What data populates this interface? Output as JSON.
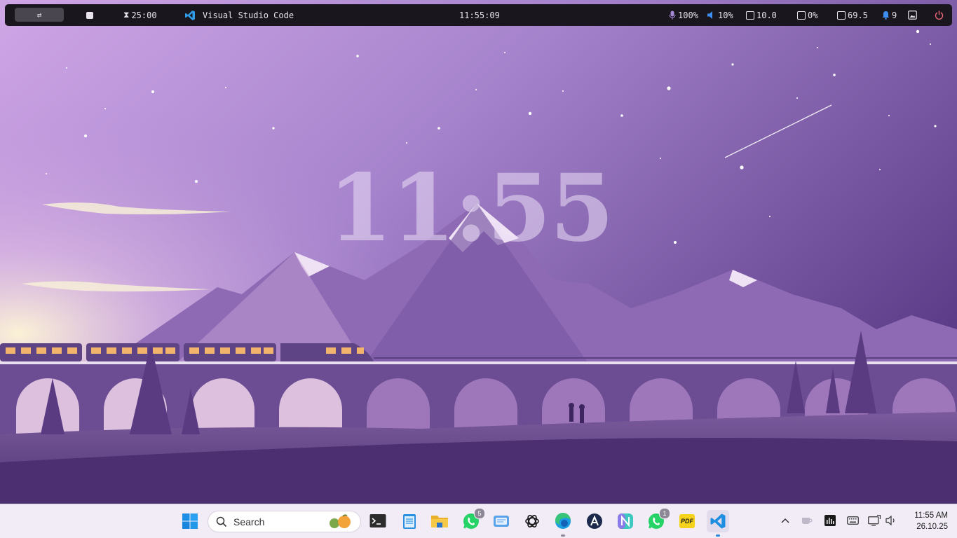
{
  "topbar": {
    "workspace_icon": "swap-arrows-icon",
    "timer": "25:00",
    "active_app": "Visual Studio Code",
    "clock": "11:55:09",
    "mic": "100%",
    "volume": "10%",
    "cpu": "10.0",
    "gpu": "0%",
    "memory": "69.5",
    "notifications": "9"
  },
  "wallpaper": {
    "clock_overlay": "11:55",
    "colors": {
      "sky_top": "#c59ee0",
      "sky_mid": "#9b78c2",
      "sky_right": "#5d3d86",
      "ground": "#4a2f6e",
      "window_amber": "#f2b46c"
    }
  },
  "taskbar": {
    "search_placeholder": "Search",
    "apps": [
      {
        "name": "Start",
        "icon": "windows-icon"
      },
      {
        "name": "Terminal",
        "icon": "terminal-icon"
      },
      {
        "name": "Notepad",
        "icon": "notepad-icon"
      },
      {
        "name": "File Explorer",
        "icon": "folder-icon"
      },
      {
        "name": "WhatsApp",
        "icon": "whatsapp-icon",
        "badge": "5"
      },
      {
        "name": "Notes",
        "icon": "notes-icon"
      },
      {
        "name": "ChatGPT",
        "icon": "chatgpt-icon"
      },
      {
        "name": "Edge",
        "icon": "edge-icon"
      },
      {
        "name": "Arc",
        "icon": "arc-icon"
      },
      {
        "name": "Notion",
        "icon": "n-app-icon"
      },
      {
        "name": "WhatsApp Beta",
        "icon": "whatsapp-icon",
        "badge": "1"
      },
      {
        "name": "PDF",
        "icon": "pdf-icon",
        "label": "PDF"
      },
      {
        "name": "Visual Studio Code",
        "icon": "vscode-icon"
      }
    ],
    "tray": [
      "chevron-up-icon",
      "coffee-icon",
      "audio-bars-icon",
      "keyboard-icon",
      "network-icon",
      "speaker-icon"
    ],
    "time": "11:55 AM",
    "date": "26.10.25"
  }
}
